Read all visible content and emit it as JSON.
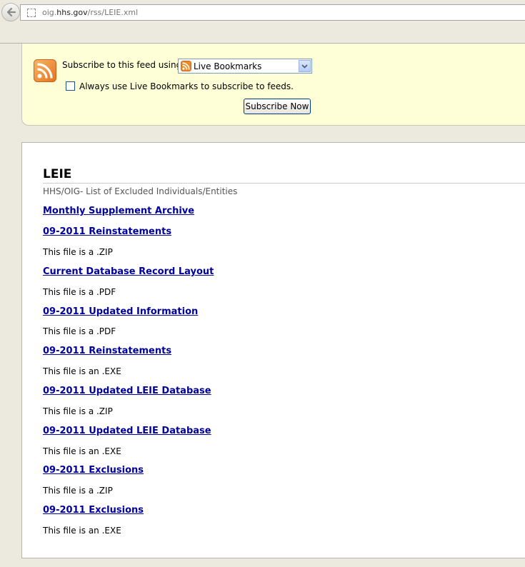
{
  "browser": {
    "url_prefix": "oig.",
    "url_host": "hhs.gov",
    "url_path": "/rss/LEIE.xml"
  },
  "subscribe": {
    "label": "Subscribe to this feed using",
    "reader_selected": "Live Bookmarks",
    "always_use_label": "Always use Live Bookmarks to subscribe to feeds.",
    "always_use_checked": false,
    "button_label": "Subscribe Now"
  },
  "feed": {
    "title": "LEIE",
    "subtitle": "HHS/OIG- List of Excluded Individuals/Entities",
    "items": [
      {
        "title": "Monthly Supplement Archive",
        "desc": ""
      },
      {
        "title": "09-2011 Reinstatements",
        "desc": "This file is a .ZIP"
      },
      {
        "title": "Current Database Record Layout",
        "desc": "This file is a .PDF"
      },
      {
        "title": "09-2011 Updated Information",
        "desc": "This file is a .PDF"
      },
      {
        "title": "09-2011 Reinstatements",
        "desc": "This file is an .EXE"
      },
      {
        "title": "09-2011 Updated LEIE Database",
        "desc": "This file is a .ZIP"
      },
      {
        "title": "09-2011 Updated LEIE Database",
        "desc": "This file is an .EXE"
      },
      {
        "title": "09-2011 Exclusions",
        "desc": "This file is a .ZIP"
      },
      {
        "title": "09-2011 Exclusions",
        "desc": "This file is an .EXE"
      }
    ]
  },
  "icons": {
    "back": "back-arrow-icon",
    "site": "site-identity-icon",
    "rss": "rss-feed-icon",
    "dropdown": "chevron-down-icon"
  },
  "colors": {
    "link": "#00009c",
    "subscribe_bg": "#ffffd7",
    "rss_orange": "#f08a24"
  }
}
